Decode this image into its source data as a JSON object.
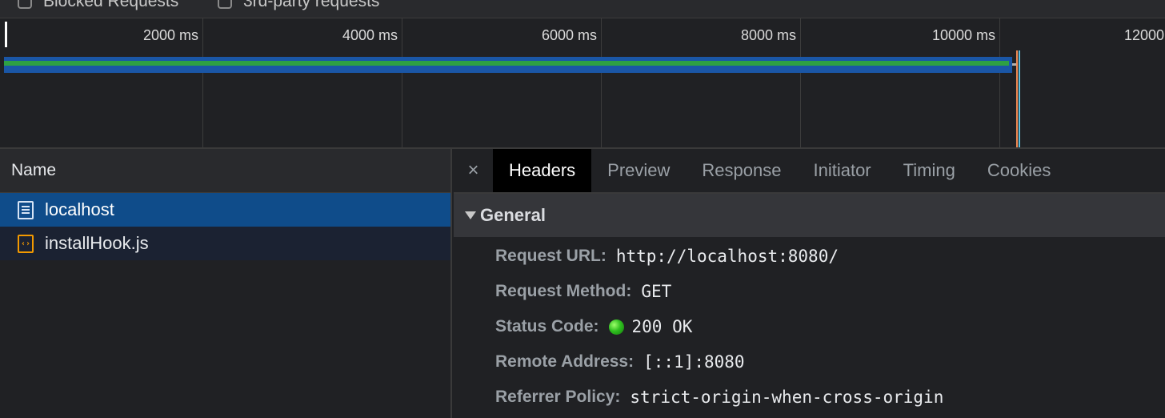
{
  "filters": [
    {
      "label": "Blocked Requests",
      "checked": false
    },
    {
      "label": "3rd-party requests",
      "checked": false
    }
  ],
  "overview": {
    "ticks": [
      "2000 ms",
      "4000 ms",
      "6000 ms",
      "8000 ms",
      "10000 ms",
      "12000"
    ],
    "colors": {
      "bar_outer": "#1a56a6",
      "bar_inner": "#2ea043",
      "dom_content_loaded": "#5bc0de",
      "load_event": "#f28b54"
    }
  },
  "requests": {
    "column_header": "Name",
    "items": [
      {
        "name": "localhost",
        "icon": "document-icon",
        "selected": true
      },
      {
        "name": "installHook.js",
        "icon": "script-icon",
        "selected": false
      }
    ]
  },
  "details": {
    "close_glyph": "×",
    "tabs": [
      "Headers",
      "Preview",
      "Response",
      "Initiator",
      "Timing",
      "Cookies"
    ],
    "active_tab": "Headers",
    "general": {
      "title": "General",
      "rows": [
        {
          "key": "Request URL:",
          "value": "http://localhost:8080/"
        },
        {
          "key": "Request Method:",
          "value": "GET"
        },
        {
          "key": "Status Code:",
          "value": "200 OK",
          "status_color": "#34c924"
        },
        {
          "key": "Remote Address:",
          "value": "[::1]:8080"
        },
        {
          "key": "Referrer Policy:",
          "value": "strict-origin-when-cross-origin"
        }
      ]
    }
  }
}
